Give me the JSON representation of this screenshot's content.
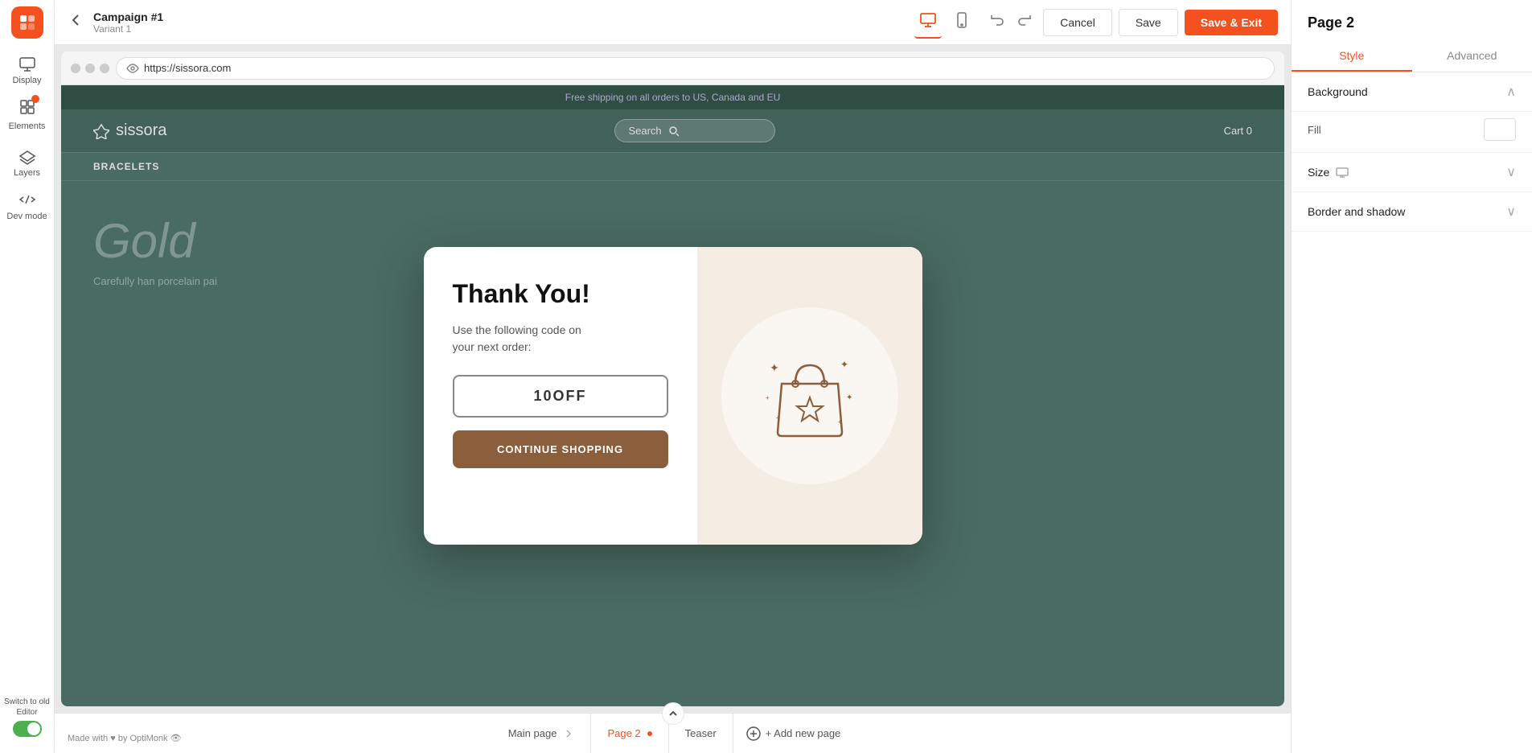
{
  "app": {
    "logo_text": "O"
  },
  "topbar": {
    "back_label": "←",
    "campaign_title": "Campaign #1",
    "campaign_variant": "Variant 1",
    "undo_label": "↩",
    "redo_label": "↪",
    "cancel_label": "Cancel",
    "save_label": "Save",
    "save_exit_label": "Save & Exit"
  },
  "sidebar_left": {
    "items": [
      {
        "id": "display",
        "icon": "display-icon",
        "label": "Display"
      },
      {
        "id": "elements",
        "icon": "elements-icon",
        "label": "Elements"
      },
      {
        "id": "layers",
        "icon": "layers-icon",
        "label": "Layers"
      },
      {
        "id": "devmode",
        "icon": "dev-icon",
        "label": "Dev mode"
      }
    ],
    "switch_label": "Switch to old Editor"
  },
  "browser": {
    "url": "https://sissora.com"
  },
  "website": {
    "announcement": "Free shipping on all orders to US, Canada and EU",
    "logo_text": "sissora",
    "search_placeholder": "Search",
    "cart_label": "Cart",
    "cart_count": "0",
    "nav_items": [
      "BRACELETS"
    ],
    "hero_title": "Gold",
    "hero_text": "Carefully han porcelain pai"
  },
  "popup": {
    "close_label": "×",
    "title": "Thank You!",
    "description_line1": "Use the following code on",
    "description_line2": "your next order:",
    "coupon_code": "10OFF",
    "cta_label": "CONTINUE SHOPPING"
  },
  "bottom_bar": {
    "pages": [
      {
        "id": "main",
        "label": "Main page",
        "active": false
      },
      {
        "id": "page2",
        "label": "Page 2",
        "active": true
      },
      {
        "id": "teaser",
        "label": "Teaser",
        "active": false
      }
    ],
    "add_page_label": "+ Add new page",
    "watermark": "Made with ♥ by OptiMonk 👁"
  },
  "right_panel": {
    "page_title": "Page 2",
    "tabs": [
      {
        "id": "style",
        "label": "Style",
        "active": true
      },
      {
        "id": "advanced",
        "label": "Advanced",
        "active": false
      }
    ],
    "sections": [
      {
        "id": "background",
        "label": "Background",
        "expanded": true
      },
      {
        "id": "fill",
        "label": "Fill",
        "is_fill": true
      },
      {
        "id": "size",
        "label": "Size",
        "expanded": false
      },
      {
        "id": "border",
        "label": "Border and shadow",
        "expanded": false
      }
    ]
  }
}
